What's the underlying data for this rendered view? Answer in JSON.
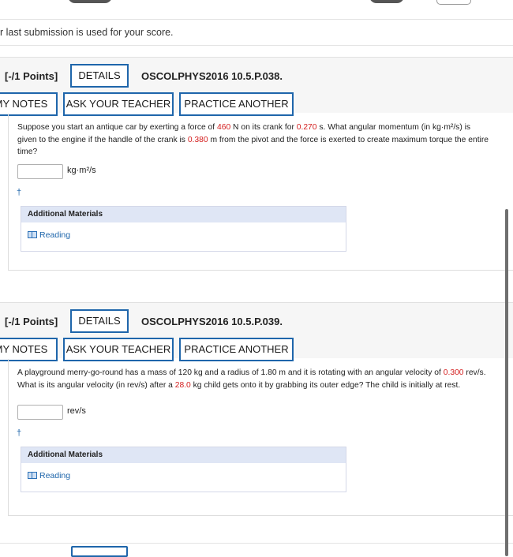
{
  "notice": "r last submission is used for your score.",
  "questions": [
    {
      "points": "[-/1 Points]",
      "details_label": "DETAILS",
      "qid": "OSCOLPHYS2016 10.5.P.038.",
      "my_notes_label": "MY NOTES",
      "ask_teacher_label": "ASK YOUR TEACHER",
      "practice_label": "PRACTICE ANOTHER",
      "text": {
        "p1": "Suppose you start an antique car by exerting a force of ",
        "v1": "460",
        "p2": " N on its crank for ",
        "v2": "0.270",
        "p3": " s. What angular momentum (in kg·m²/s) is given to the engine if the handle of the crank is ",
        "v3": "0.380",
        "p4": " m from the pivot and the force is exerted to create maximum torque the entire time?"
      },
      "answer_value": "",
      "unit": "kg·m²/s",
      "dagger": "†",
      "additional_materials_label": "Additional Materials",
      "reading_label": "Reading"
    },
    {
      "points": "[-/1 Points]",
      "details_label": "DETAILS",
      "qid": "OSCOLPHYS2016 10.5.P.039.",
      "my_notes_label": "MY NOTES",
      "ask_teacher_label": "ASK YOUR TEACHER",
      "practice_label": "PRACTICE ANOTHER",
      "text": {
        "p1": "A playground merry-go-round has a mass of 120 kg and a radius of 1.80 m and it is rotating with an angular velocity of ",
        "v1": "0.300",
        "p2": " rev/s. What is its angular velocity (in rev/s) after a ",
        "v2": "28.0",
        "p3": " kg child gets onto it by grabbing its outer edge? The child is initially at rest."
      },
      "answer_value": "",
      "unit": "rev/s",
      "dagger": "†",
      "additional_materials_label": "Additional Materials",
      "reading_label": "Reading"
    }
  ]
}
